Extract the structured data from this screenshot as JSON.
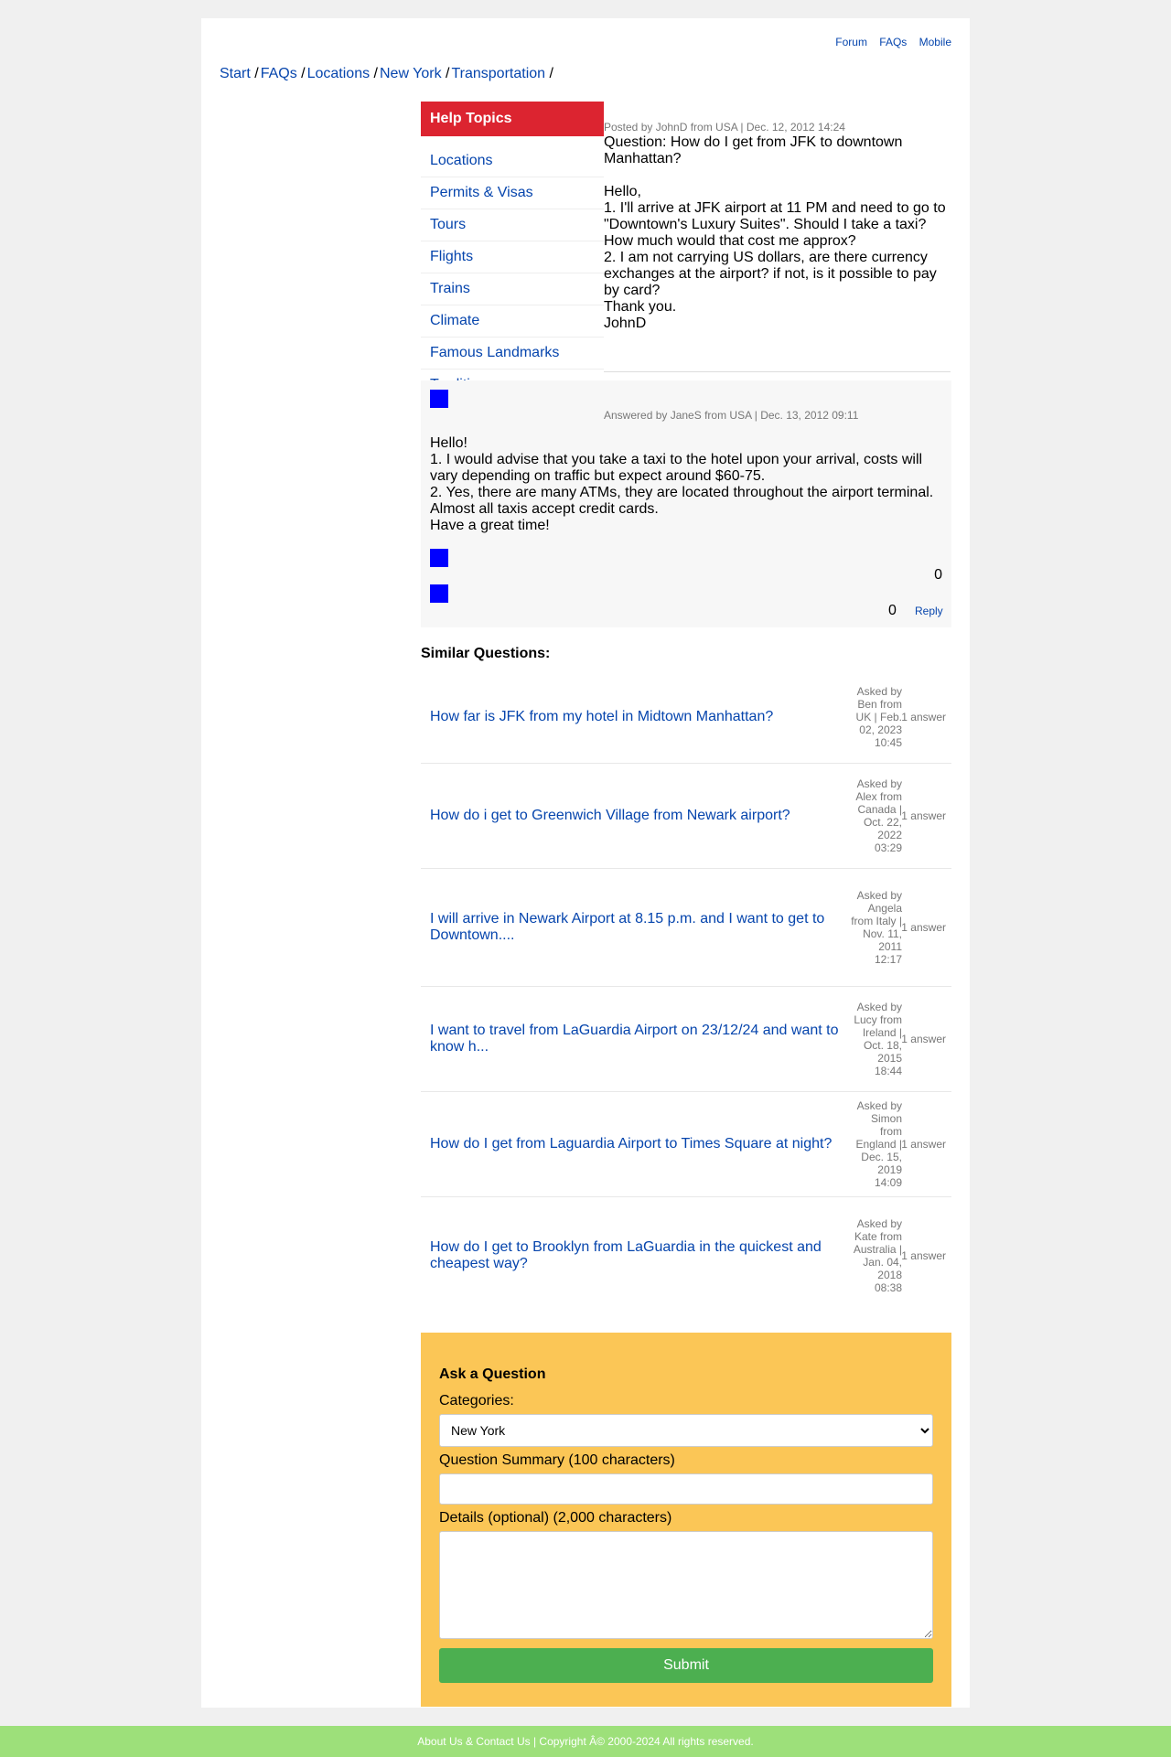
{
  "toplinks": [
    "Forum",
    "FAQs",
    "Mobile"
  ],
  "breadcrumb": [
    "Start",
    "FAQs",
    "Locations",
    "New York",
    "Transportation"
  ],
  "sidebar": {
    "title": "Help Topics",
    "items": [
      "Locations",
      "Permits & Visas",
      "Tours",
      "Flights",
      "Trains",
      "Climate",
      "Famous Landmarks",
      "Traditions"
    ]
  },
  "question": {
    "meta": "Posted by JohnD from USA | Dec. 12, 2012 14:24",
    "title": "Question: How do I get from JFK to downtown Manhattan?",
    "body": [
      "Hello,",
      "1. I'll arrive at JFK airport at 11 PM and need to go to \"Downtown's Luxury Suites\". Should I take a taxi? How much would that cost me approx?",
      "2. I am not carrying US dollars, are there currency exchanges at the airport? if not, is it possible to pay by card?",
      "Thank you.",
      "JohnD"
    ]
  },
  "answer": {
    "meta": "Answered by JaneS from USA | Dec. 13, 2012 09:11",
    "body": [
      "Hello!",
      "1. I would advise that you take a taxi to the hotel upon your arrival, costs will vary depending on traffic but expect around $60-75.",
      "2. Yes, there are many ATMs, they are located throughout the airport terminal. Almost all taxis accept credit cards.",
      "Have a great time!"
    ],
    "upvotes": "0",
    "downvotes": "0",
    "reply_label": "Reply"
  },
  "similar": {
    "heading": "Similar Questions:",
    "items": [
      {
        "question": "How far is JFK from my hotel in Midtown Manhattan?",
        "meta": "Asked by Ben from UK | Feb. 02, 2023 10:45",
        "answers": "1 answer"
      },
      {
        "question": "How do i get to Greenwich Village from Newark airport?",
        "meta": "Asked by Alex from Canada | Oct. 22, 2022 03:29",
        "answers": "1 answer"
      },
      {
        "question": "I will arrive in Newark Airport at 8.15 p.m. and I want to get to Downtown....",
        "meta": "Asked by Angela from Italy | Nov. 11, 2011 12:17",
        "answers": "1 answer"
      },
      {
        "question": "I want to travel from LaGuardia Airport on 23/12/24 and want to know h...",
        "meta": "Asked by Lucy from Ireland | Oct. 18, 2015 18:44",
        "answers": "1 answer"
      },
      {
        "question": "How do I get from Laguardia Airport to Times Square at night?",
        "meta": "Asked by Simon from England | Dec. 15, 2019 14:09",
        "answers": "1 answer"
      },
      {
        "question": "How do I get to Brooklyn from LaGuardia in the quickest and cheapest way?",
        "meta": "Asked by Kate from Australia | Jan. 04, 2018 08:38",
        "answers": "1 answer"
      }
    ]
  },
  "ask": {
    "heading": "Ask a Question",
    "categories_label": "Categories:",
    "category_selected": "New York",
    "summary_label": "Question Summary (100 characters)",
    "details_label": "Details (optional) (2,000 characters)",
    "submit_label": "Submit"
  },
  "footer": "About Us & Contact Us | Copyright Â© 2000-2024 All rights reserved."
}
